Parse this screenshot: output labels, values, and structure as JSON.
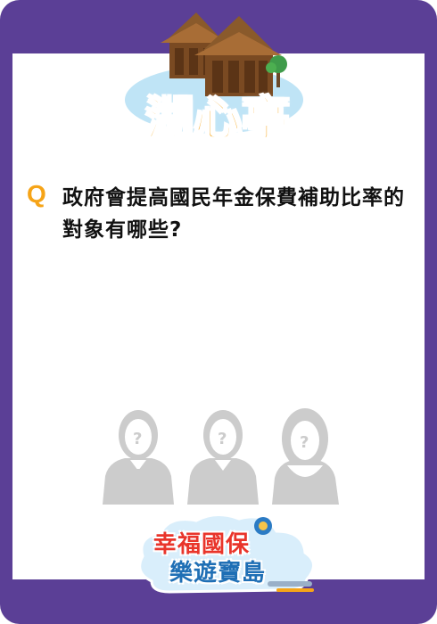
{
  "header": {
    "location_title": "湖心亭"
  },
  "question": {
    "marker": "Q",
    "text": "政府會提高國民年金保費補助比率的對象有哪些?"
  },
  "logo": {
    "line1": "幸福國保",
    "line2": "樂遊寶島"
  },
  "colors": {
    "frame": "#5b3f96",
    "accent": "#f6a417",
    "logo_red": "#e9352b",
    "logo_blue": "#1f6fb5"
  }
}
